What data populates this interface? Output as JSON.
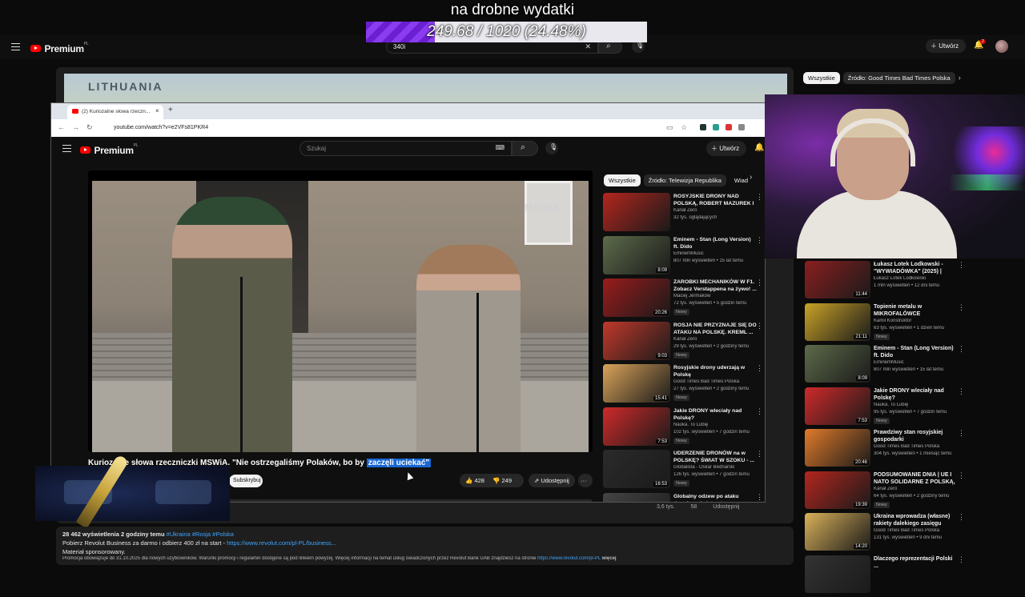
{
  "overlay": {
    "goal_title": "na drobne wydatki",
    "goal_progress": "249.68 / 1020 (24.48%)",
    "goal_fraction": 0.2448
  },
  "outer_header": {
    "logo": "Premium",
    "logo_sup": "PL",
    "search_value": "340i",
    "create_label": "Utwórz",
    "notif_count": "2"
  },
  "outer_map": {
    "label": "LITHUANIA"
  },
  "outer_chips": [
    "Wszystkie",
    "Źródło: Good Times Bad Times Polska"
  ],
  "browser": {
    "tab_title": "(2) Kuriozalne słowa rzeczn...",
    "url": "youtube.com/watch?v=e2VFs81PKR4"
  },
  "inner_header": {
    "logo": "Premium",
    "logo_sup": "PL",
    "search_placeholder": "Szukaj",
    "create_label": "Utwórz"
  },
  "video": {
    "watermark": "MSWiA",
    "title_plain": "Kuriozalne słowa rzeczniczki MSWiA. \"Nie ostrzegaliśmy Polaków, bo by ",
    "title_highlight": "zaczęli uciekać\"",
    "subscribe_label": "Subskrybuj",
    "likes": "428",
    "dislikes": "249",
    "share_label": "Udostępnij",
    "more": "···"
  },
  "inner_chips": [
    "Wszystkie",
    "Źródło: Telewizja Republika",
    "Wiad"
  ],
  "inner_recs": [
    {
      "title": "ROSYJSKIE DRONY NAD POLSKĄ, ROBERT MAZUREK I ...",
      "channel": "Kanał Zero",
      "meta": "32 tys. oglądających",
      "badge": "",
      "duration": "",
      "color": "#b3261e"
    },
    {
      "title": "Eminem - Stan (Long Version) ft. Dido",
      "channel": "EminemMusic",
      "meta": "807 mln wyświetleń • 15 lat temu",
      "badge": "",
      "duration": "8:09",
      "color": "#5d6b4a"
    },
    {
      "title": "ZAROBKI MECHANIKÓW W F1. Zobacz Verstappena na żywo! ...",
      "channel": "Maciej Jermakow",
      "meta": "72 tys. wyświetleń • 5 godzin temu",
      "badge": "Nowy",
      "duration": "20:26",
      "color": "#9a1c1c"
    },
    {
      "title": "ROSJA NIE PRZYZNAJE SIĘ DO ATAKU NA POLSKĘ. KREML ...",
      "channel": "Kanał Zero",
      "meta": "29 tys. wyświetleń • 2 godziny temu",
      "badge": "Nowy",
      "duration": "9:03",
      "color": "#c0392b"
    },
    {
      "title": "Rosyjskie drony uderzają w Polskę",
      "channel": "Good Times Bad Times Polska",
      "meta": "27 tys. wyświetleń • 2 godziny temu",
      "badge": "Nowy",
      "duration": "15:41",
      "color": "#d9a35a"
    },
    {
      "title": "Jakie DRONY wleciały nad Polskę?",
      "channel": "Nauka. To Lubię",
      "meta": "102 tys. wyświetleń • 7 godzin temu",
      "badge": "Nowy",
      "duration": "7:53",
      "color": "#cf2a2a"
    },
    {
      "title": "UDERZENIE DRONÓW na w POLSKĘ? ŚWIAT W SZOKU - ...",
      "channel": "Globalista - Oskar Bednarski",
      "meta": "126 tys. wyświetleń • 7 godzin temu",
      "badge": "Nowy",
      "duration": "16:53",
      "color": "#2b2b2b"
    },
    {
      "title": "Globalny odzew po ataku dronów – świat patrzy na ...",
      "channel": "",
      "meta": "",
      "badge": "",
      "duration": "",
      "color": "#444"
    }
  ],
  "inner_under": {
    "views": "3,6 tys.",
    "num": "58",
    "share_label": "Udostępnij"
  },
  "outer_recs": [
    {
      "title": "Łukasz Lotek Lodkowski - \"WYWIADÓWKA\" (2025) | Stan...",
      "channel": "Łukasz Lotek Lodkowski",
      "meta": "1 mln wyświetleń • 12 dni temu",
      "badge": "",
      "duration": "11:44",
      "color": "#8a1f1f"
    },
    {
      "title": "Topienie metalu w MIKROFALÓWCE",
      "channel": "Kamil Konstruktor",
      "meta": "63 tys. wyświetleń • 1 dzień temu",
      "badge": "Nowy",
      "duration": "21:11",
      "color": "#c9a227"
    },
    {
      "title": "Eminem - Stan (Long Version) ft. Dido",
      "channel": "EminemMusic",
      "meta": "807 mln wyświetleń • 15 lat temu",
      "badge": "",
      "duration": "8:09",
      "color": "#5d6b4a"
    },
    {
      "title": "Jakie DRONY wleciały nad Polskę?",
      "channel": "Nauka. To Lubię",
      "meta": "95 tys. wyświetleń • 7 godzin temu",
      "badge": "Nowy",
      "duration": "7:53",
      "color": "#cf2a2a"
    },
    {
      "title": "Prawdziwy stan rosyjskiej gospodarki",
      "channel": "Good Times Bad Times Polska",
      "meta": "304 tys. wyświetleń • 1 miesiąc temu",
      "badge": "",
      "duration": "20:46",
      "color": "#e07b2a"
    },
    {
      "title": "PODSUMOWANIE DNIA | UE I NATO SOLIDARNE Z POLSKĄ, ...",
      "channel": "Kanał Zero",
      "meta": "64 tys. wyświetleń • 2 godziny temu",
      "badge": "Nowy",
      "duration": "19:39",
      "color": "#b3261e"
    },
    {
      "title": "Ukraina wprowadza (własne) rakiety dalekiego zasięgu",
      "channel": "Good Times Bad Times Polska",
      "meta": "131 tys. wyświetleń • 9 dni temu",
      "badge": "",
      "duration": "14:20",
      "color": "#d9b15a"
    },
    {
      "title": "Dlaczego reprezentacji Polski ...",
      "channel": "",
      "meta": "",
      "badge": "",
      "duration": "",
      "color": "#333"
    }
  ],
  "outer_desc": {
    "stats": "28 462 wyświetlenia  2 godziny temu",
    "tags": "#Ukraina #Rosja #Polska",
    "promo": "Pobierz Revolut Business za darmo i odbierz 400 zł na start - ",
    "promo_link": "https://www.revolut.com/pl-PL/business...",
    "sponsored": "Materiał sponsorowany.",
    "terms": "Promocja obowiązuje do 31.10.2025 dla nowych użytkowników. Warunki promocji i regulamin dostępne są pod linkiem powyżej. Więcej informacji na temat usług świadczonych przez Revolut Bank UAB znajdziesz na stronie",
    "terms_link": "https://www.revolut.com/pl-PL",
    "more": "więcej"
  }
}
